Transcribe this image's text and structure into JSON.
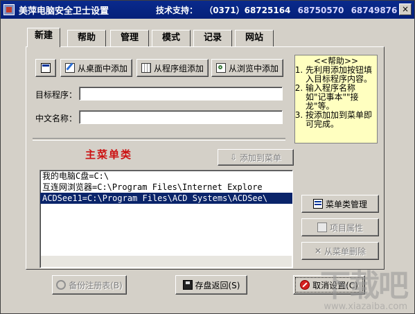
{
  "window": {
    "title": "美萍电脑安全卫士设置",
    "tech_support_label": "技术支持：",
    "phones": [
      "（0371）68725164",
      "68750570",
      "68749876"
    ],
    "close_glyph": "×"
  },
  "tabs": [
    {
      "label": "新建",
      "active": true
    },
    {
      "label": "帮助",
      "active": false
    },
    {
      "label": "管理",
      "active": false
    },
    {
      "label": "模式",
      "active": false
    },
    {
      "label": "记录",
      "active": false
    },
    {
      "label": "网站",
      "active": false
    }
  ],
  "toolbar": {
    "add_from_desktop": "从桌面中添加",
    "add_from_program_group": "从程序组添加",
    "add_from_browse": "从浏览中添加"
  },
  "form": {
    "target_label": "目标程序：",
    "target_value": "",
    "name_label": "中文名称：",
    "name_value": ""
  },
  "help": {
    "heading": "<<帮助>>",
    "items": [
      "先利用添加按钮填入目标程序内容。",
      "输入程序名称如\"记事本\"\"接龙\"等。",
      "按添加加到菜单即可完成。"
    ]
  },
  "main_menu": {
    "title": "主菜单类",
    "add_to_menu": "添加到菜单",
    "items": [
      {
        "text": "我的电脑C盘=C:\\",
        "selected": false
      },
      {
        "text": "互连网浏览器=C:\\Program Files\\Internet Explore",
        "selected": false
      },
      {
        "text": "ACDSee11=C:\\Program Files\\ACD Systems\\ACDSee\\",
        "selected": true
      }
    ]
  },
  "side_buttons": {
    "category_manage": "菜单类管理",
    "item_properties": "项目属性",
    "delete_from_menu": "从菜单删除"
  },
  "bottom": {
    "backup_registry": "备份注册表(B)",
    "save_return": "存盘返回(S)",
    "cancel_settings": "取消设置(C)"
  },
  "watermark": {
    "logo": "下载吧",
    "url": "www.xiazaiba.com"
  }
}
